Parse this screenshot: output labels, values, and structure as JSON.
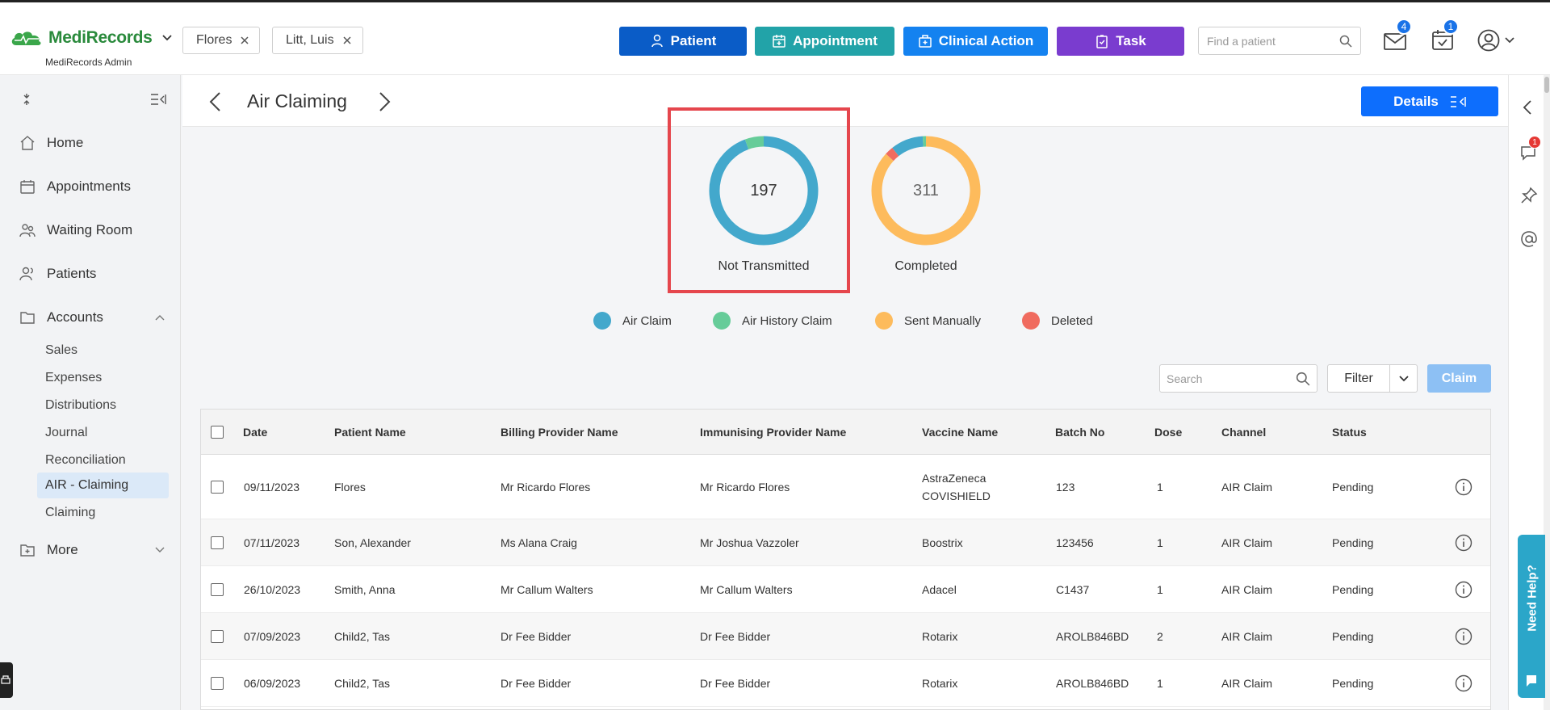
{
  "header": {
    "logo_name": "MediRecords",
    "logo_sub": "MediRecords Admin",
    "chips": [
      {
        "label": "Flores"
      },
      {
        "label": "Litt, Luis"
      }
    ],
    "buttons": {
      "patient": "Patient",
      "appointment": "Appointment",
      "clinical_action": "Clinical Action",
      "task": "Task"
    },
    "find_placeholder": "Find a patient",
    "mail_count": "4",
    "tasks_count": "1",
    "colors": {
      "patient": "#0a5cc7",
      "appointment": "#22a3a8",
      "clinical_action": "#1482f0",
      "task": "#7a3ccf"
    }
  },
  "sidebar": {
    "items": [
      {
        "label": "Home",
        "icon": "home-icon"
      },
      {
        "label": "Appointments",
        "icon": "calendar-icon"
      },
      {
        "label": "Waiting Room",
        "icon": "people-icon"
      },
      {
        "label": "Patients",
        "icon": "patients-icon"
      },
      {
        "label": "Accounts",
        "icon": "folder-icon"
      }
    ],
    "accounts_sub": [
      "Sales",
      "Expenses",
      "Distributions",
      "Journal",
      "Reconciliation",
      "AIR - Claiming",
      "Claiming"
    ],
    "more_label": "More"
  },
  "page": {
    "title": "Air Claiming",
    "details_label": "Details"
  },
  "chart_data": [
    {
      "type": "pie",
      "center_value": "197",
      "title": "Not Transmitted",
      "categories": [
        "Air Claim",
        "Air History Claim"
      ],
      "values": [
        186,
        11
      ],
      "colors": [
        "#43a8cc",
        "#66cc99"
      ]
    },
    {
      "type": "pie",
      "center_value": "311",
      "title": "Completed",
      "categories": [
        "Sent Manually",
        "Deleted",
        "Air Claim",
        "Air History Claim"
      ],
      "values": [
        270,
        8,
        30,
        3
      ],
      "colors": [
        "#fdbb5c",
        "#f06b5f",
        "#43a8cc",
        "#66cc99"
      ]
    }
  ],
  "legend": [
    {
      "label": "Air Claim",
      "color": "#43a8cc"
    },
    {
      "label": "Air History Claim",
      "color": "#66cc99"
    },
    {
      "label": "Sent Manually",
      "color": "#fdbb5c"
    },
    {
      "label": "Deleted",
      "color": "#f06b5f"
    }
  ],
  "toolbar": {
    "search_placeholder": "Search",
    "filter_label": "Filter",
    "claim_label": "Claim"
  },
  "table": {
    "columns": [
      "Date",
      "Patient Name",
      "Billing Provider Name",
      "Immunising Provider Name",
      "Vaccine Name",
      "Batch No",
      "Dose",
      "Channel",
      "Status"
    ],
    "rows": [
      {
        "date": "09/11/2023",
        "patient": "Flores",
        "billing": "Mr Ricardo Flores",
        "immunising": "Mr Ricardo Flores",
        "vaccine": "AstraZeneca",
        "vaccine2": "COVISHIELD",
        "batch": "123",
        "dose": "1",
        "channel": "AIR Claim",
        "status": "Pending"
      },
      {
        "date": "07/11/2023",
        "patient": "Son, Alexander",
        "billing": "Ms Alana Craig",
        "immunising": "Mr Joshua Vazzoler",
        "vaccine": "Boostrix",
        "vaccine2": "",
        "batch": "123456",
        "dose": "1",
        "channel": "AIR Claim",
        "status": "Pending"
      },
      {
        "date": "26/10/2023",
        "patient": "Smith, Anna",
        "billing": "Mr Callum Walters",
        "immunising": "Mr Callum Walters",
        "vaccine": "Adacel",
        "vaccine2": "",
        "batch": "C1437",
        "dose": "1",
        "channel": "AIR Claim",
        "status": "Pending"
      },
      {
        "date": "07/09/2023",
        "patient": "Child2, Tas",
        "billing": "Dr Fee Bidder",
        "immunising": "Dr Fee Bidder",
        "vaccine": "Rotarix",
        "vaccine2": "",
        "batch": "AROLB846BD",
        "dose": "2",
        "channel": "AIR Claim",
        "status": "Pending"
      },
      {
        "date": "06/09/2023",
        "patient": "Child2, Tas",
        "billing": "Dr Fee Bidder",
        "immunising": "Dr Fee Bidder",
        "vaccine": "Rotarix",
        "vaccine2": "",
        "batch": "AROLB846BD",
        "dose": "1",
        "channel": "AIR Claim",
        "status": "Pending"
      }
    ]
  },
  "right_rail": {
    "comments_badge": "1",
    "help_label": "Need Help?"
  }
}
